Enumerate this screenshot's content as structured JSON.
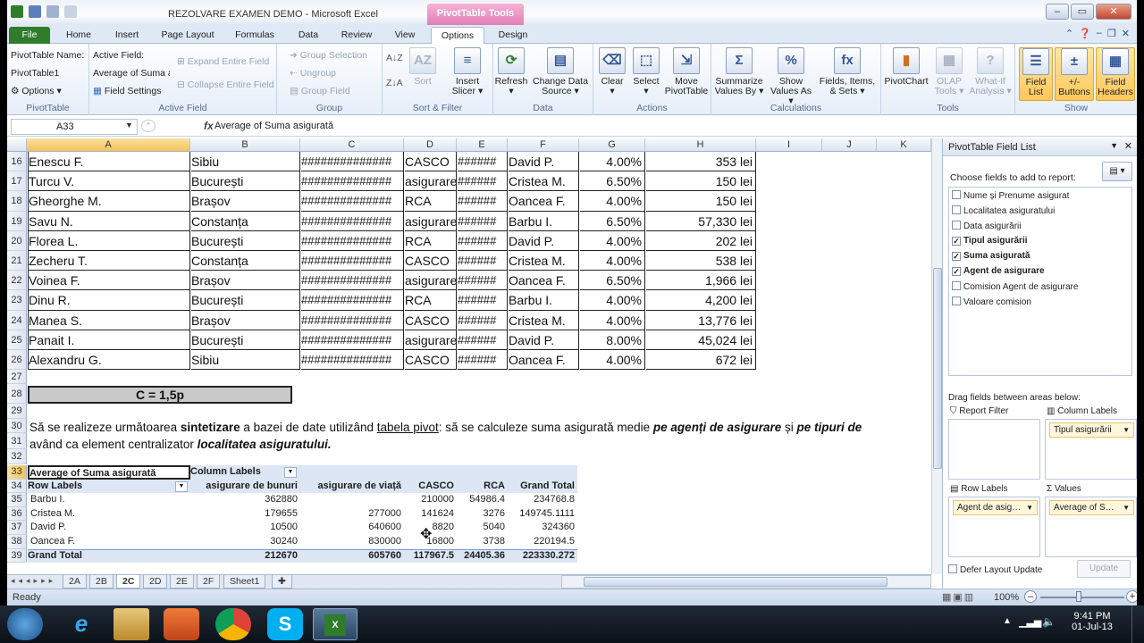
{
  "window": {
    "title": "REZOLVARE EXAMEN DEMO - Microsoft Excel",
    "context_tab": "PivotTable Tools",
    "controls": [
      "–",
      "▭",
      "✕"
    ]
  },
  "ribbon_tabs": [
    "File",
    "Home",
    "Insert",
    "Page Layout",
    "Formulas",
    "Data",
    "Review",
    "View",
    "Options",
    "Design"
  ],
  "selected_tab": "Options",
  "ribbon": {
    "pivottable": {
      "name_label": "PivotTable Name:",
      "name_value": "PivotTable1",
      "options": "Options ▾",
      "group": "PivotTable"
    },
    "active_field": {
      "label": "Active Field:",
      "value": "Average of Suma a",
      "field_settings": "Field Settings",
      "expand": "Expand Entire Field",
      "collapse": "Collapse Entire Field",
      "group": "Active Field"
    },
    "group": {
      "selection": "Group Selection",
      "ungroup": "Ungroup",
      "group_field": "Group Field",
      "group": "Group"
    },
    "sort_filter": {
      "sort": "Sort",
      "insert_slicer": "Insert\nSlicer ▾",
      "group": "Sort & Filter"
    },
    "data": {
      "refresh": "Refresh\n▾",
      "change_source": "Change Data\nSource ▾",
      "group": "Data"
    },
    "actions": {
      "clear": "Clear\n▾",
      "select": "Select\n▾",
      "move": "Move\nPivotTable",
      "group": "Actions"
    },
    "calculations": {
      "summarize": "Summarize\nValues By ▾",
      "show": "Show\nValues As ▾",
      "fields": "Fields, Items,\n& Sets ▾",
      "group": "Calculations"
    },
    "tools": {
      "pivotchart": "PivotChart",
      "olap": "OLAP\nTools ▾",
      "whatif": "What-If\nAnalysis ▾",
      "group": "Tools"
    },
    "show": {
      "field_list": "Field\nList",
      "buttons": "+/-\nButtons",
      "headers": "Field\nHeaders",
      "group": "Show"
    }
  },
  "formula_bar": {
    "name_box": "A33",
    "fx": "fx",
    "value": "Average of Suma asigurată"
  },
  "columns": [
    "A",
    "B",
    "C",
    "D",
    "E",
    "F",
    "G",
    "H",
    "I",
    "J",
    "K"
  ],
  "data_rows": [
    {
      "row": "16",
      "name": "Enescu F.",
      "loc": "Sibiu",
      "date": "##############",
      "type": "CASCO",
      "amt": "######",
      "agent": "David P.",
      "pct": "4.00%",
      "val": "353 lei"
    },
    {
      "row": "17",
      "name": "Turcu V.",
      "loc": "București",
      "date": "##############",
      "type": "asigurare",
      "amt": "######",
      "agent": "Cristea M.",
      "pct": "6.50%",
      "val": "150 lei"
    },
    {
      "row": "18",
      "name": "Gheorghe M.",
      "loc": "Brașov",
      "date": "##############",
      "type": "RCA",
      "amt": "######",
      "agent": "Oancea F.",
      "pct": "4.00%",
      "val": "150 lei"
    },
    {
      "row": "19",
      "name": "Savu N.",
      "loc": "Constanța",
      "date": "##############",
      "type": "asigurare",
      "amt": "######",
      "agent": "Barbu I.",
      "pct": "6.50%",
      "val": "57,330 lei"
    },
    {
      "row": "20",
      "name": "Florea L.",
      "loc": "București",
      "date": "##############",
      "type": "RCA",
      "amt": "######",
      "agent": "David P.",
      "pct": "4.00%",
      "val": "202 lei"
    },
    {
      "row": "21",
      "name": "Zecheru T.",
      "loc": "Constanța",
      "date": "##############",
      "type": "CASCO",
      "amt": "######",
      "agent": "Cristea M.",
      "pct": "4.00%",
      "val": "538 lei"
    },
    {
      "row": "22",
      "name": "Voinea F.",
      "loc": "Brașov",
      "date": "##############",
      "type": "asigurare",
      "amt": "######",
      "agent": "Oancea F.",
      "pct": "6.50%",
      "val": "1,966 lei"
    },
    {
      "row": "23",
      "name": "Dinu R.",
      "loc": "București",
      "date": "##############",
      "type": "RCA",
      "amt": "######",
      "agent": "Barbu I.",
      "pct": "4.00%",
      "val": "4,200 lei"
    },
    {
      "row": "24",
      "name": "Manea S.",
      "loc": "Brașov",
      "date": "##############",
      "type": "CASCO",
      "amt": "######",
      "agent": "Cristea M.",
      "pct": "4.00%",
      "val": "13,776 lei"
    },
    {
      "row": "25",
      "name": "Panait I.",
      "loc": "București",
      "date": "##############",
      "type": "asigurare",
      "amt": "######",
      "agent": "David P.",
      "pct": "8.00%",
      "val": "45,024 lei"
    },
    {
      "row": "26",
      "name": "Alexandru G.",
      "loc": "Sibiu",
      "date": "##############",
      "type": "CASCO",
      "amt": "######",
      "agent": "Oancea F.",
      "pct": "4.00%",
      "val": "672 lei"
    }
  ],
  "extra_rows": [
    "27",
    "28",
    "29",
    "30",
    "31",
    "32"
  ],
  "c28_label": "C = 1,5p",
  "task": {
    "line1_a": "Să se realizeze următoarea ",
    "line1_b": "sintetizare",
    "line1_c": " a bazei de date utilizând ",
    "line1_d": "tabela pivot",
    "line1_e": ": să se calculeze suma asigurată medie ",
    "line1_f": "pe agenți de asigurare",
    "line1_g": "  și ",
    "line1_h": "pe tipuri de",
    "line2_a": "având ca element centralizator ",
    "line2_b": "localitatea asiguratului."
  },
  "pivot": {
    "rows": [
      "33",
      "34",
      "35",
      "36",
      "37",
      "38",
      "39"
    ],
    "title": "Average of Suma asigurată",
    "col_labels": "Column Labels",
    "row_labels": "Row Labels",
    "headers": [
      "asigurare de bunuri",
      "asigurare de viață",
      "CASCO",
      "RCA",
      "Grand Total"
    ],
    "body": [
      {
        "label": "Barbu I.",
        "v": [
          "362880",
          "",
          "210000",
          "54986.4",
          "234768.8"
        ]
      },
      {
        "label": "Cristea M.",
        "v": [
          "179655",
          "277000",
          "141624",
          "3276",
          "149745.1111"
        ]
      },
      {
        "label": "David P.",
        "v": [
          "10500",
          "640600",
          "8820",
          "5040",
          "324360"
        ]
      },
      {
        "label": "Oancea F.",
        "v": [
          "30240",
          "830000",
          "16800",
          "3738",
          "220194.5"
        ]
      }
    ],
    "total": {
      "label": "Grand Total",
      "v": [
        "212670",
        "605760",
        "117967.5",
        "24405.36",
        "223330.272"
      ]
    }
  },
  "sheet_tabs": [
    "2A",
    "2B",
    "2C",
    "2D",
    "2E",
    "2F",
    "Sheet1"
  ],
  "selected_sheet": "2C",
  "status": {
    "ready": "Ready",
    "zoom": "100%"
  },
  "field_list": {
    "title": "PivotTable Field List",
    "choose": "Choose fields to add to report:",
    "fields": [
      {
        "label": "Nume și Prenume asigurat",
        "checked": false
      },
      {
        "label": "Localitatea asiguratului",
        "checked": false
      },
      {
        "label": "Data asigurării",
        "checked": false
      },
      {
        "label": "Tipul asigurării",
        "checked": true
      },
      {
        "label": "Suma asigurată",
        "checked": true
      },
      {
        "label": "Agent de asigurare",
        "checked": true
      },
      {
        "label": "Comision Agent de asigurare",
        "checked": false
      },
      {
        "label": "Valoare comision",
        "checked": false
      }
    ],
    "drag": "Drag fields between areas below:",
    "report_filter": "Report Filter",
    "column_labels": "Column Labels",
    "row_labels": "Row Labels",
    "values": "Values",
    "col_chip": "Tipul asigurării",
    "row_chip": "Agent de asig…",
    "val_chip": "Average of S…",
    "defer": "Defer Layout Update",
    "update": "Update"
  },
  "taskbar": {
    "time": "9:41 PM",
    "date": "01-Jul-13"
  }
}
